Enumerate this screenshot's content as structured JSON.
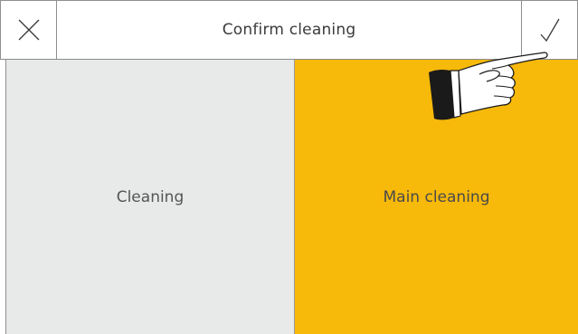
{
  "header": {
    "title": "Confirm cleaning",
    "cancel_icon": "close-icon",
    "confirm_icon": "checkmark-icon"
  },
  "panels": {
    "left_label": "Cleaning",
    "right_label": "Main cleaning"
  },
  "colors": {
    "left_panel": "#e8e9e9",
    "right_panel": "#f7b90a"
  },
  "annotation": {
    "icon": "pointing-hand-icon"
  }
}
